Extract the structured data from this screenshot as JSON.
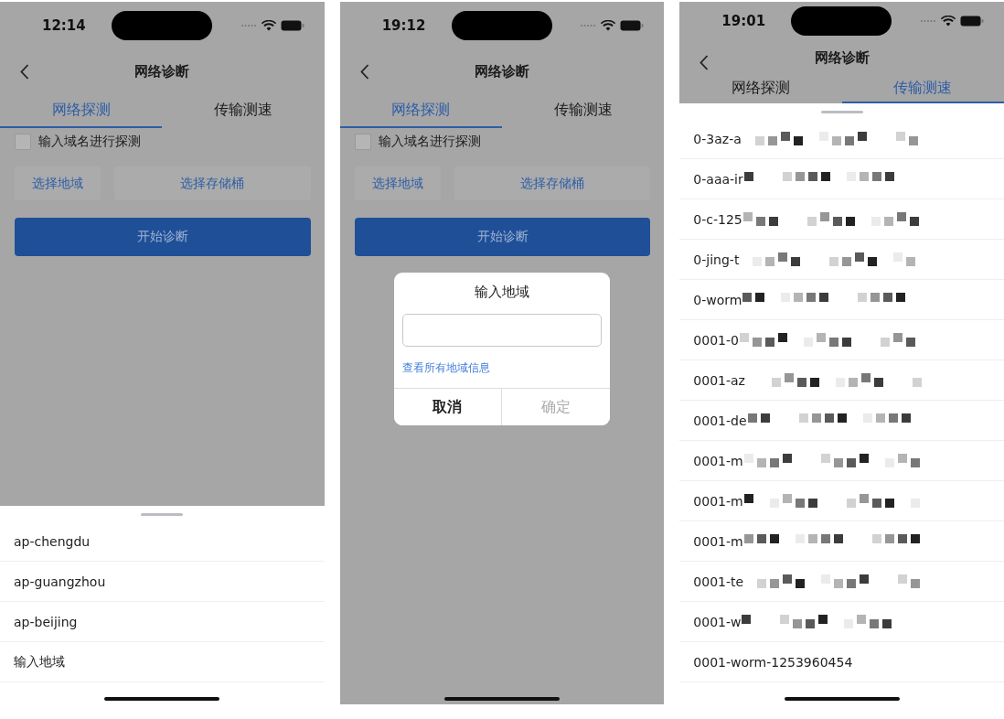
{
  "screens": [
    {
      "time": "12:14",
      "title": "网络诊断",
      "dimmed": true,
      "tabs": [
        {
          "label": "网络探测",
          "selected": true
        },
        {
          "label": "传输测速",
          "selected": false
        }
      ],
      "checkbox": {
        "label": "输入域名进行探测",
        "checked": false
      },
      "pickers": [
        "选择地域",
        "选择存储桶"
      ],
      "start_button": "开始诊断",
      "overlay": {
        "kind": "sheet",
        "items": [
          {
            "label": "ap-chengdu",
            "redacted": false
          },
          {
            "label": "ap-guangzhou",
            "redacted": false
          },
          {
            "label": "ap-beijing",
            "redacted": false
          },
          {
            "label": "输入地域",
            "redacted": false
          }
        ]
      }
    },
    {
      "time": "19:12",
      "title": "网络诊断",
      "dimmed": true,
      "tabs": [
        {
          "label": "网络探测",
          "selected": true
        },
        {
          "label": "传输测速",
          "selected": false
        }
      ],
      "checkbox": {
        "label": "输入域名进行探测",
        "checked": false
      },
      "pickers": [
        "选择地域",
        "选择存储桶"
      ],
      "start_button": "开始诊断",
      "overlay": {
        "kind": "dialog",
        "title": "输入地域",
        "link": "查看所有地域信息",
        "buttons": [
          {
            "label": "取消",
            "disabled": false
          },
          {
            "label": "确定",
            "disabled": true
          }
        ]
      }
    },
    {
      "time": "19:01",
      "title": "网络诊断",
      "dimmed": true,
      "tabs": [
        {
          "label": "网络探测",
          "selected": false
        },
        {
          "label": "传输测速",
          "selected": true
        }
      ],
      "overlay": {
        "kind": "sheet",
        "items": [
          {
            "label": "0-3az-a",
            "redacted": true
          },
          {
            "label": "0-aaa-ir",
            "redacted": true
          },
          {
            "label": "0-c-125",
            "redacted": true
          },
          {
            "label": "0-jing-t",
            "redacted": true
          },
          {
            "label": "0-worm",
            "redacted": true
          },
          {
            "label": "0001-0",
            "redacted": true
          },
          {
            "label": "0001-az",
            "redacted": true
          },
          {
            "label": "0001-de",
            "redacted": true
          },
          {
            "label": "0001-m",
            "redacted": true
          },
          {
            "label": "0001-m",
            "redacted": true
          },
          {
            "label": "0001-m",
            "redacted": true
          },
          {
            "label": "0001-te",
            "redacted": true
          },
          {
            "label": "0001-w",
            "redacted": true
          },
          {
            "label": "0001-worm-1253960454",
            "redacted": false
          }
        ]
      }
    }
  ]
}
